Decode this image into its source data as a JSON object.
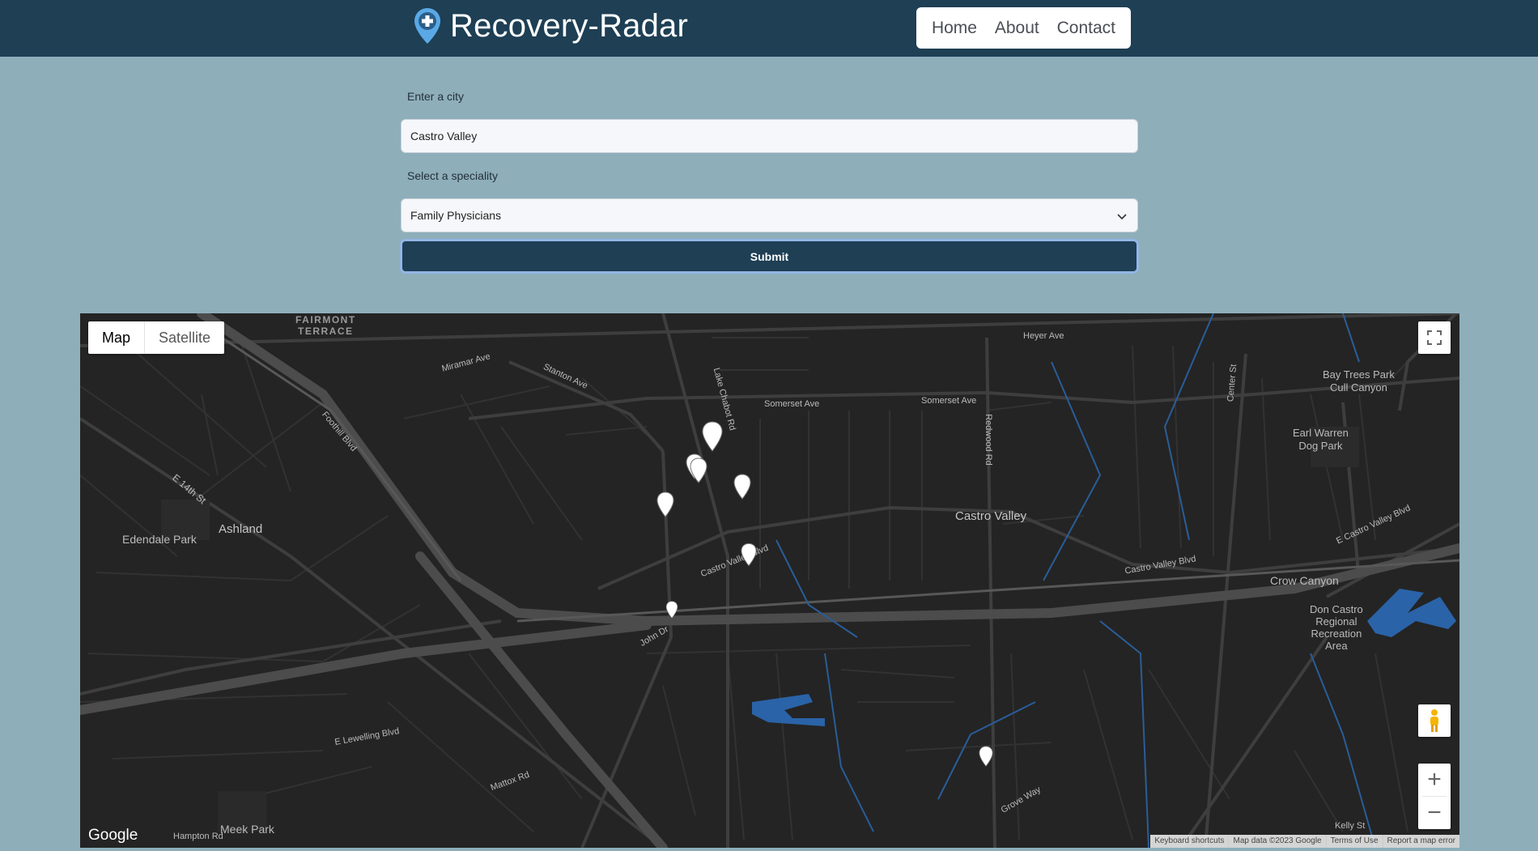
{
  "brand": {
    "name": "Recovery-Radar"
  },
  "nav": {
    "home": "Home",
    "about": "About",
    "contact": "Contact"
  },
  "form": {
    "city_label": "Enter a city",
    "city_value": "Castro Valley",
    "speciality_label": "Select a speciality",
    "speciality_selected": "Family Physicians",
    "submit_label": "Submit"
  },
  "map": {
    "type_map": "Map",
    "type_satellite": "Satellite",
    "zoom_in": "+",
    "zoom_out": "−",
    "google": "Google",
    "attribution": {
      "shortcuts": "Keyboard shortcuts",
      "data": "Map data ©2023 Google",
      "terms": "Terms of Use",
      "report": "Report a map error"
    },
    "places": {
      "castro_valley": "Castro Valley",
      "ashland": "Ashland",
      "edendale": "Edendale Park",
      "crow_canyon": "Crow Canyon",
      "earl_warren": "Earl Warren",
      "dog_park": "Dog Park",
      "bay_trees": "Bay Trees Park",
      "cull_canyon": "Cull Canyon",
      "don_castro": "Don Castro",
      "regional": "Regional",
      "recreation": "Recreation",
      "area": "Area",
      "meek_park": "Meek Park",
      "fairmont": "FAIRMONT",
      "terrace": "TERRACE"
    },
    "streets": {
      "foothill": "Foothill Blvd",
      "e14th": "E 14th St",
      "somerset": "Somerset Ave",
      "somerset2": "Somerset Ave",
      "castro_valley_blvd": "Castro Valley Blvd",
      "castro_valley_blvd2": "Castro Valley Blvd",
      "redwood": "Redwood Rd",
      "lake_chabot": "Lake Chabot Rd",
      "stanton": "Stanton Ave",
      "miramar": "Miramar Ave",
      "heyer": "Heyer Ave",
      "e_lewelling": "E Lewelling Blvd",
      "mattox": "Mattox Rd",
      "grove_way": "Grove Way",
      "john_dr": "John Dr",
      "center_st": "Center St",
      "kelly_st": "Kelly St",
      "hampton": "Hampton Rd",
      "e_castro_valley": "E Castro Valley Blvd"
    },
    "colors": {
      "land": "#242424",
      "road": "#3c3c3c",
      "highway": "#4a4a4a",
      "water": "#2a63a8",
      "label": "#bbbbbb"
    }
  }
}
